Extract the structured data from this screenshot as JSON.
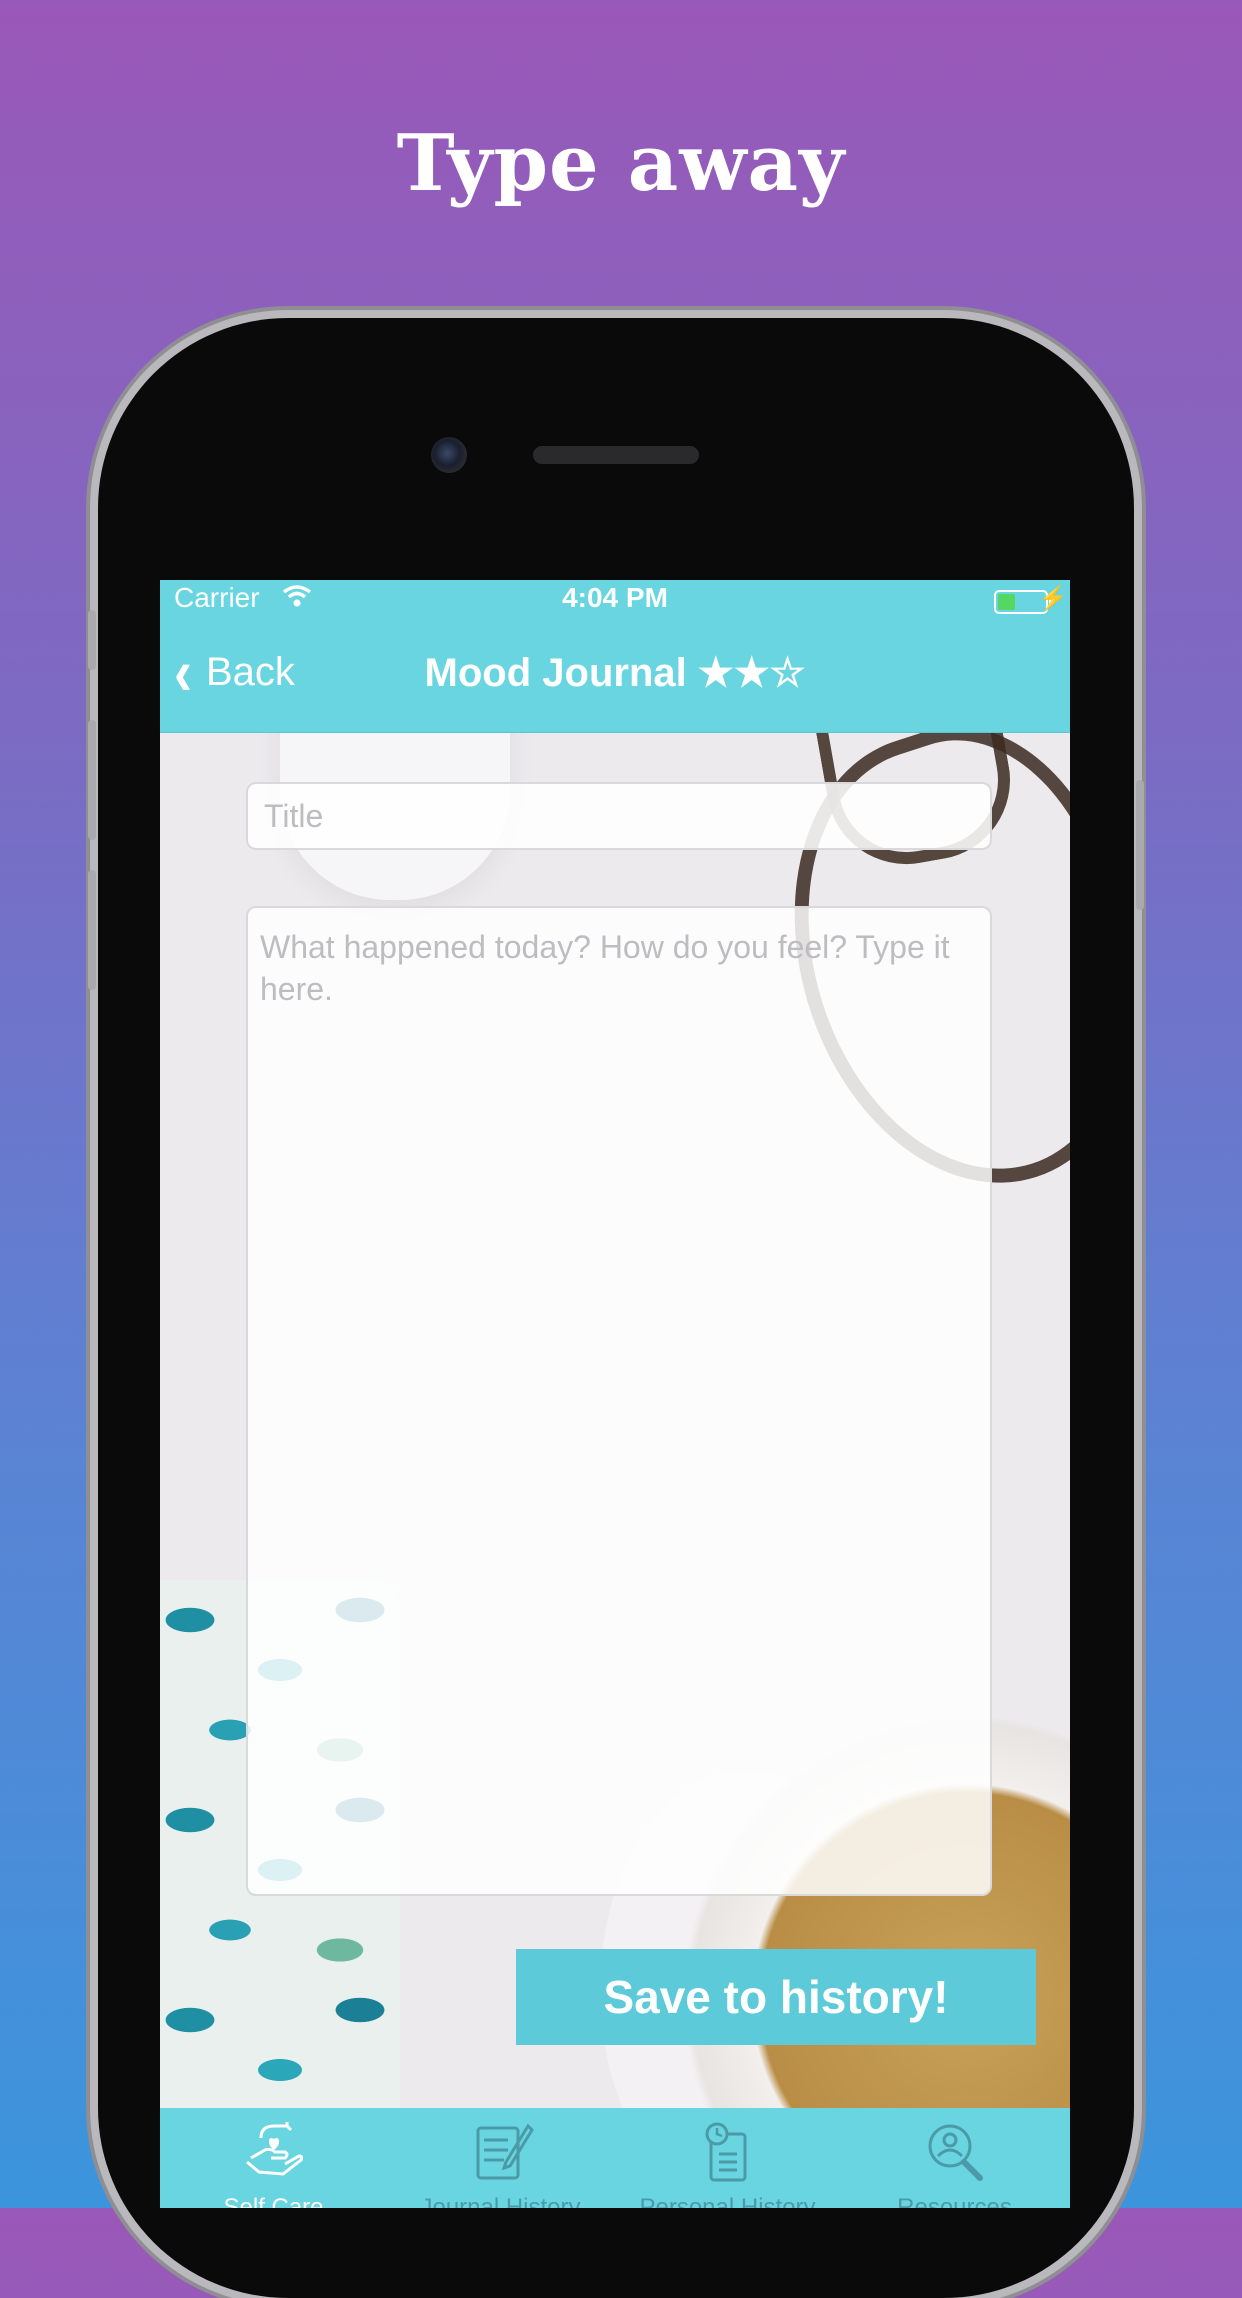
{
  "headline": "Type away",
  "status_bar": {
    "carrier": "Carrier",
    "time": "4:04 PM"
  },
  "nav": {
    "back_label": "Back",
    "title": "Mood Journal ★★☆"
  },
  "form": {
    "title_placeholder": "Title",
    "body_placeholder": "What happened today? How do you feel? Type it here.",
    "save_label": "Save to history!"
  },
  "tabs": [
    {
      "label": "Self Care",
      "icon": "self-care-icon",
      "active": true
    },
    {
      "label": "Journal History",
      "icon": "journal-history-icon",
      "active": false
    },
    {
      "label": "Personal History",
      "icon": "personal-history-icon",
      "active": false
    },
    {
      "label": "Resources",
      "icon": "resources-icon",
      "active": false
    }
  ],
  "colors": {
    "accent": "#68d5e1",
    "button": "#5ccad8",
    "gradient_top": "#9a58b8",
    "gradient_bottom": "#3b95dc"
  }
}
